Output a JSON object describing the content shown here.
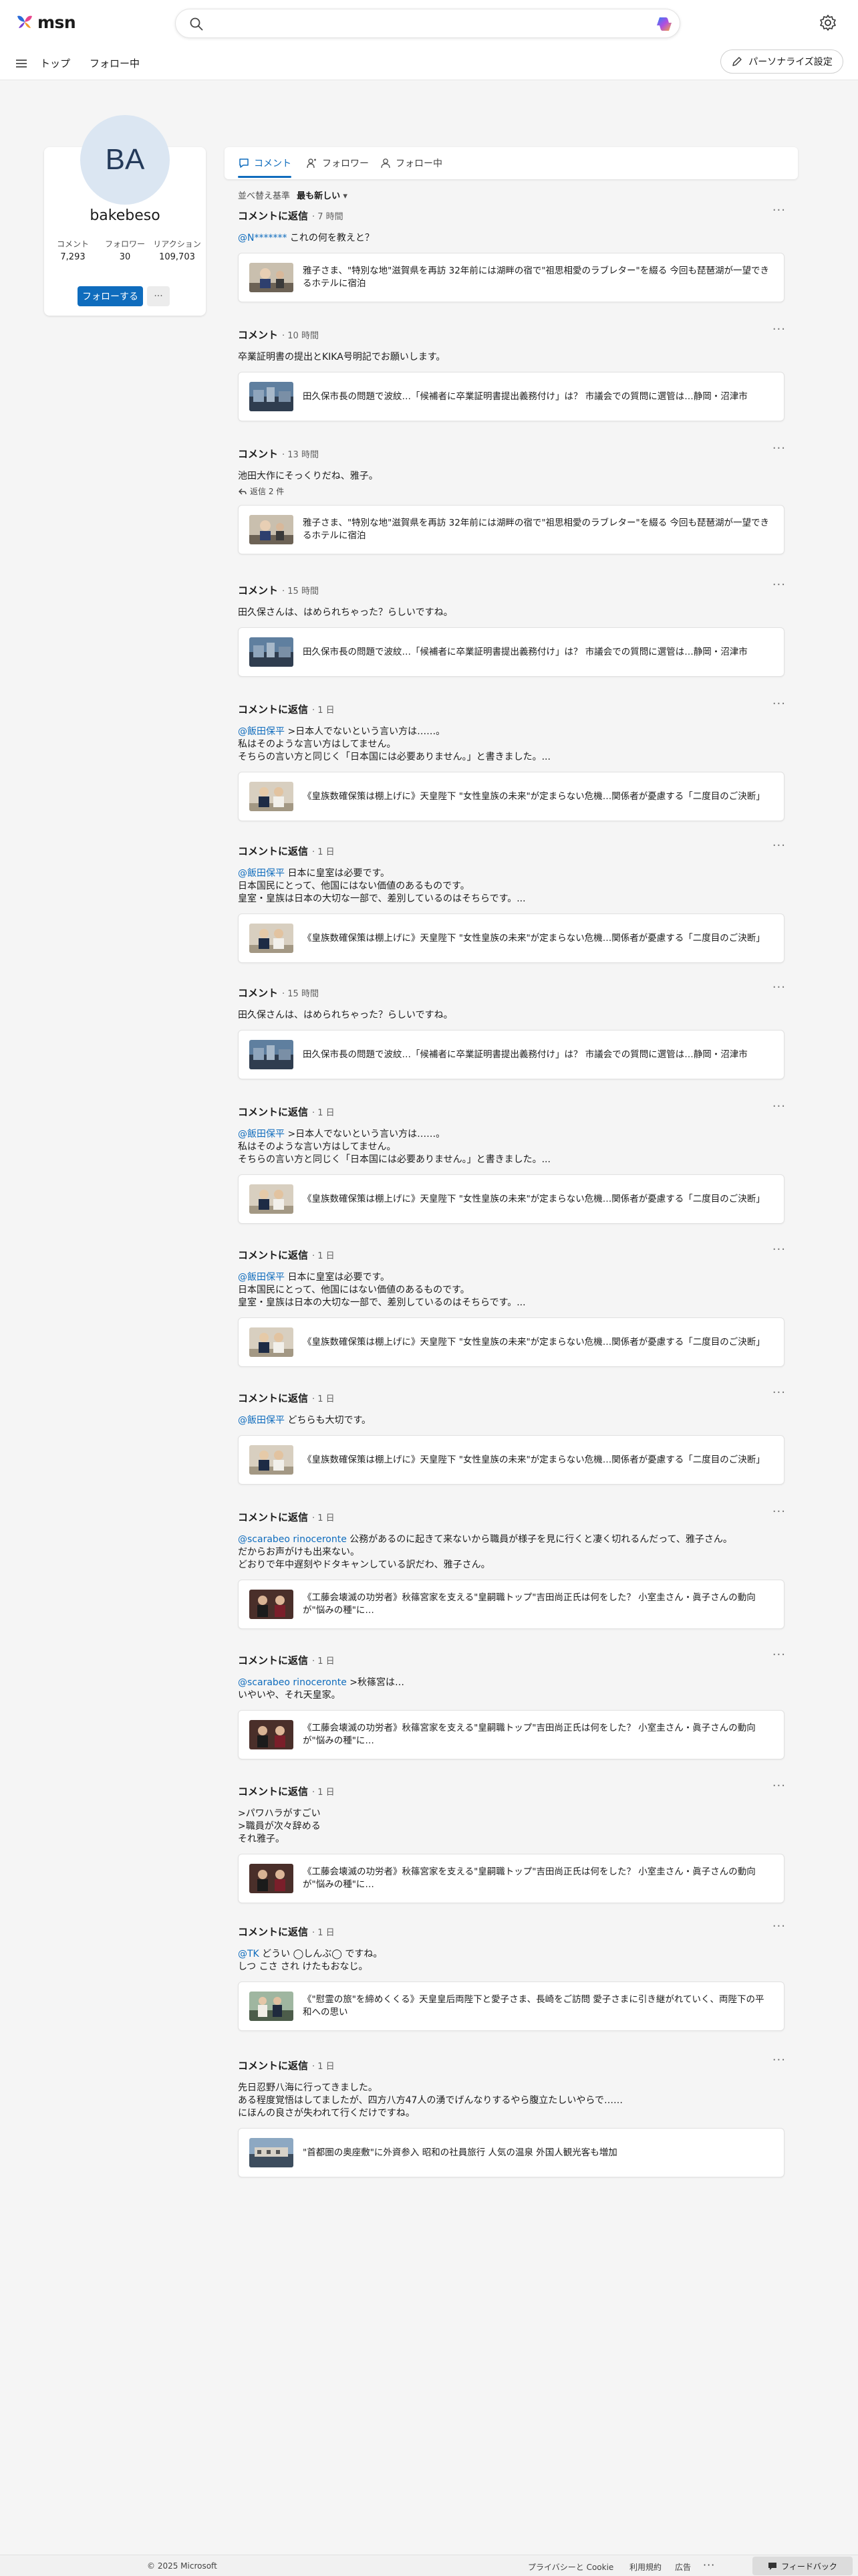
{
  "header": {
    "brand": "msn",
    "search_placeholder": ""
  },
  "nav": {
    "top": "トップ",
    "following": "フォロー中",
    "personalize": "パーソナライズ設定"
  },
  "profile": {
    "initials": "BA",
    "name": "bakebeso",
    "stats": [
      {
        "label": "コメント",
        "value": "7,293"
      },
      {
        "label": "フォロワー",
        "value": "30"
      },
      {
        "label": "リアクション",
        "value": "109,703"
      }
    ],
    "follow_label": "フォローする",
    "more_label": "···"
  },
  "tabs": {
    "comments": "コメント",
    "following": "フォロワー",
    "followers": "フォロー中"
  },
  "sort": {
    "label": "並べ替え基準",
    "value": "最も新しい"
  },
  "comments": [
    {
      "type": "コメントに返信",
      "time": "7 時間",
      "mention": "@N*******",
      "text": " これの何を教えと？",
      "article": "雅子さま、\"特別な地\"滋賀県を再訪 32年前には湖畔の宿で\"祖思相愛のラブレター\"を綴る 今回も琵琶湖が一望できるホテルに宿泊",
      "thumb": "masako"
    },
    {
      "type": "コメント",
      "time": "10 時間",
      "mention": "",
      "text": "卒業証明書の提出とKIKA号明記でお願いします。",
      "article": "田久保市長の問題で波紋…「候補者に卒業証明書提出義務付け」は？ 市議会での質問に選管は…静岡・沼津市",
      "thumb": "city"
    },
    {
      "type": "コメント",
      "time": "13 時間",
      "mention": "",
      "text": "池田大作にそっくりだね、雅子。",
      "replies": "返信 2 件",
      "article": "雅子さま、\"特別な地\"滋賀県を再訪 32年前には湖畔の宿で\"祖思相愛のラブレター\"を綴る 今回も琵琶湖が一望できるホテルに宿泊",
      "thumb": "masako"
    },
    {
      "type": "コメント",
      "time": "15 時間",
      "mention": "",
      "text": "田久保さんは、はめられちゃった？らしいですね。",
      "article": "田久保市長の問題で波紋…「候補者に卒業証明書提出義務付け」は？ 市議会での質問に選管は…静岡・沼津市",
      "thumb": "city"
    },
    {
      "type": "コメントに返信",
      "time": "1 日",
      "mention": "@飯田保平",
      "text": " >日本人でないという言い方は……。\n 私はそのような言い方はしてません。\nそちらの言い方と同じく「日本国には必要ありません。」と書きました。...",
      "article": "《皇族数確保策は棚上げに》天皇陛下 \"女性皇族の未来\"が定まらない危機…関係者が憂慮する「二度目のご決断」",
      "thumb": "emperor"
    },
    {
      "type": "コメントに返信",
      "time": "1 日",
      "mention": "@飯田保平",
      "text": " 日本に皇室は必要です。\n日本国民にとって、他国にはない価値のあるものです。\n皇室・皇族は日本の大切な一部で、差別しているのはそちらです。...",
      "article": "《皇族数確保策は棚上げに》天皇陛下 \"女性皇族の未来\"が定まらない危機…関係者が憂慮する「二度目のご決断」",
      "thumb": "emperor"
    },
    {
      "type": "コメント",
      "time": "15 時間",
      "mention": "",
      "text": "田久保さんは、はめられちゃった？らしいですね。",
      "article": "田久保市長の問題で波紋…「候補者に卒業証明書提出義務付け」は？ 市議会での質問に選管は…静岡・沼津市",
      "thumb": "city"
    },
    {
      "type": "コメントに返信",
      "time": "1 日",
      "mention": "@飯田保平",
      "text": " >日本人でないという言い方は……。\n 私はそのような言い方はしてません。\nそちらの言い方と同じく「日本国には必要ありません。」と書きました。...",
      "article": "《皇族数確保策は棚上げに》天皇陛下 \"女性皇族の未来\"が定まらない危機…関係者が憂慮する「二度目のご決断」",
      "thumb": "emperor"
    },
    {
      "type": "コメントに返信",
      "time": "1 日",
      "mention": "@飯田保平",
      "text": " 日本に皇室は必要です。\n日本国民にとって、他国にはない価値のあるものです。\n皇室・皇族は日本の大切な一部で、差別しているのはそちらです。...",
      "article": "《皇族数確保策は棚上げに》天皇陛下 \"女性皇族の未来\"が定まらない危機…関係者が憂慮する「二度目のご決断」",
      "thumb": "emperor"
    },
    {
      "type": "コメントに返信",
      "time": "1 日",
      "mention": "@飯田保平",
      "text": " どちらも大切です。",
      "article": "《皇族数確保策は棚上げに》天皇陛下 \"女性皇族の未来\"が定まらない危機…関係者が憂慮する「二度目のご決断」",
      "thumb": "emperor"
    },
    {
      "type": "コメントに返信",
      "time": "1 日",
      "mention": "@scarabeo rinoceronte",
      "text": " 公務があるのに起きて来ないから職員が様子を見に行くと凄く切れるんだって、雅子さん。\nだからお声がけも出来ない。\nどおりで年中遅刻やドタキャンしている訳だわ、雅子さん。",
      "article": "《工藤会壊滅の功労者》秋篠宮家を支える\"皇嗣職トップ\"吉田尚正氏は何をした？ 小室圭さん・眞子さんの動向が\"悩みの種\"に…",
      "thumb": "official"
    },
    {
      "type": "コメントに返信",
      "time": "1 日",
      "mention": "@scarabeo rinoceronte",
      "text": " >秋篠宮は…\n いやいや、それ天皇家。",
      "article": "《工藤会壊滅の功労者》秋篠宮家を支える\"皇嗣職トップ\"吉田尚正氏は何をした？ 小室圭さん・眞子さんの動向が\"悩みの種\"に…",
      "thumb": "official"
    },
    {
      "type": "コメントに返信",
      "time": "1 日",
      "mention": "",
      "text": ">パワハラがすごい\n>職員が次々辞める\n それ雅子。",
      "article": "《工藤会壊滅の功労者》秋篠宮家を支える\"皇嗣職トップ\"吉田尚正氏は何をした？ 小室圭さん・眞子さんの動向が\"悩みの種\"に…",
      "thumb": "official"
    },
    {
      "type": "コメントに返信",
      "time": "1 日",
      "mention": "@TK",
      "text": " どうい ◯しんぶ◯ ですね。\nしつ こさ され けたもおなじ。",
      "article": "《\"慰霊の旅\"を締めくくる》天皇皇后両陛下と愛子さま、長崎をご訪問 愛子さまに引き継がれていく、両陛下の平和への思い",
      "thumb": "couple"
    },
    {
      "type": "コメントに返信",
      "time": "1 日",
      "mention": "",
      "text": "先日忍野八海に行ってきました。\nある程度覚悟はしてましたが、四方八方47人の湧でげんなりするやら腹立たしいやらで……\nにほんの良さが失われて行くだけですね。",
      "article": "\"首都圏の奥座敷\"に外資参入 昭和の社員旅行 人気の温泉 外国人観光客も増加",
      "thumb": "onsen"
    }
  ],
  "footer": {
    "copyright": "© 2025 Microsoft",
    "privacy": "プライバシーと Cookie",
    "terms": "利用規約",
    "ads": "広告",
    "more": "···",
    "feedback": "フィードバック"
  },
  "colors": {
    "accent": "#0f6cbd",
    "background": "#f5f5f5",
    "avatar_bg": "#dbe6f2"
  }
}
